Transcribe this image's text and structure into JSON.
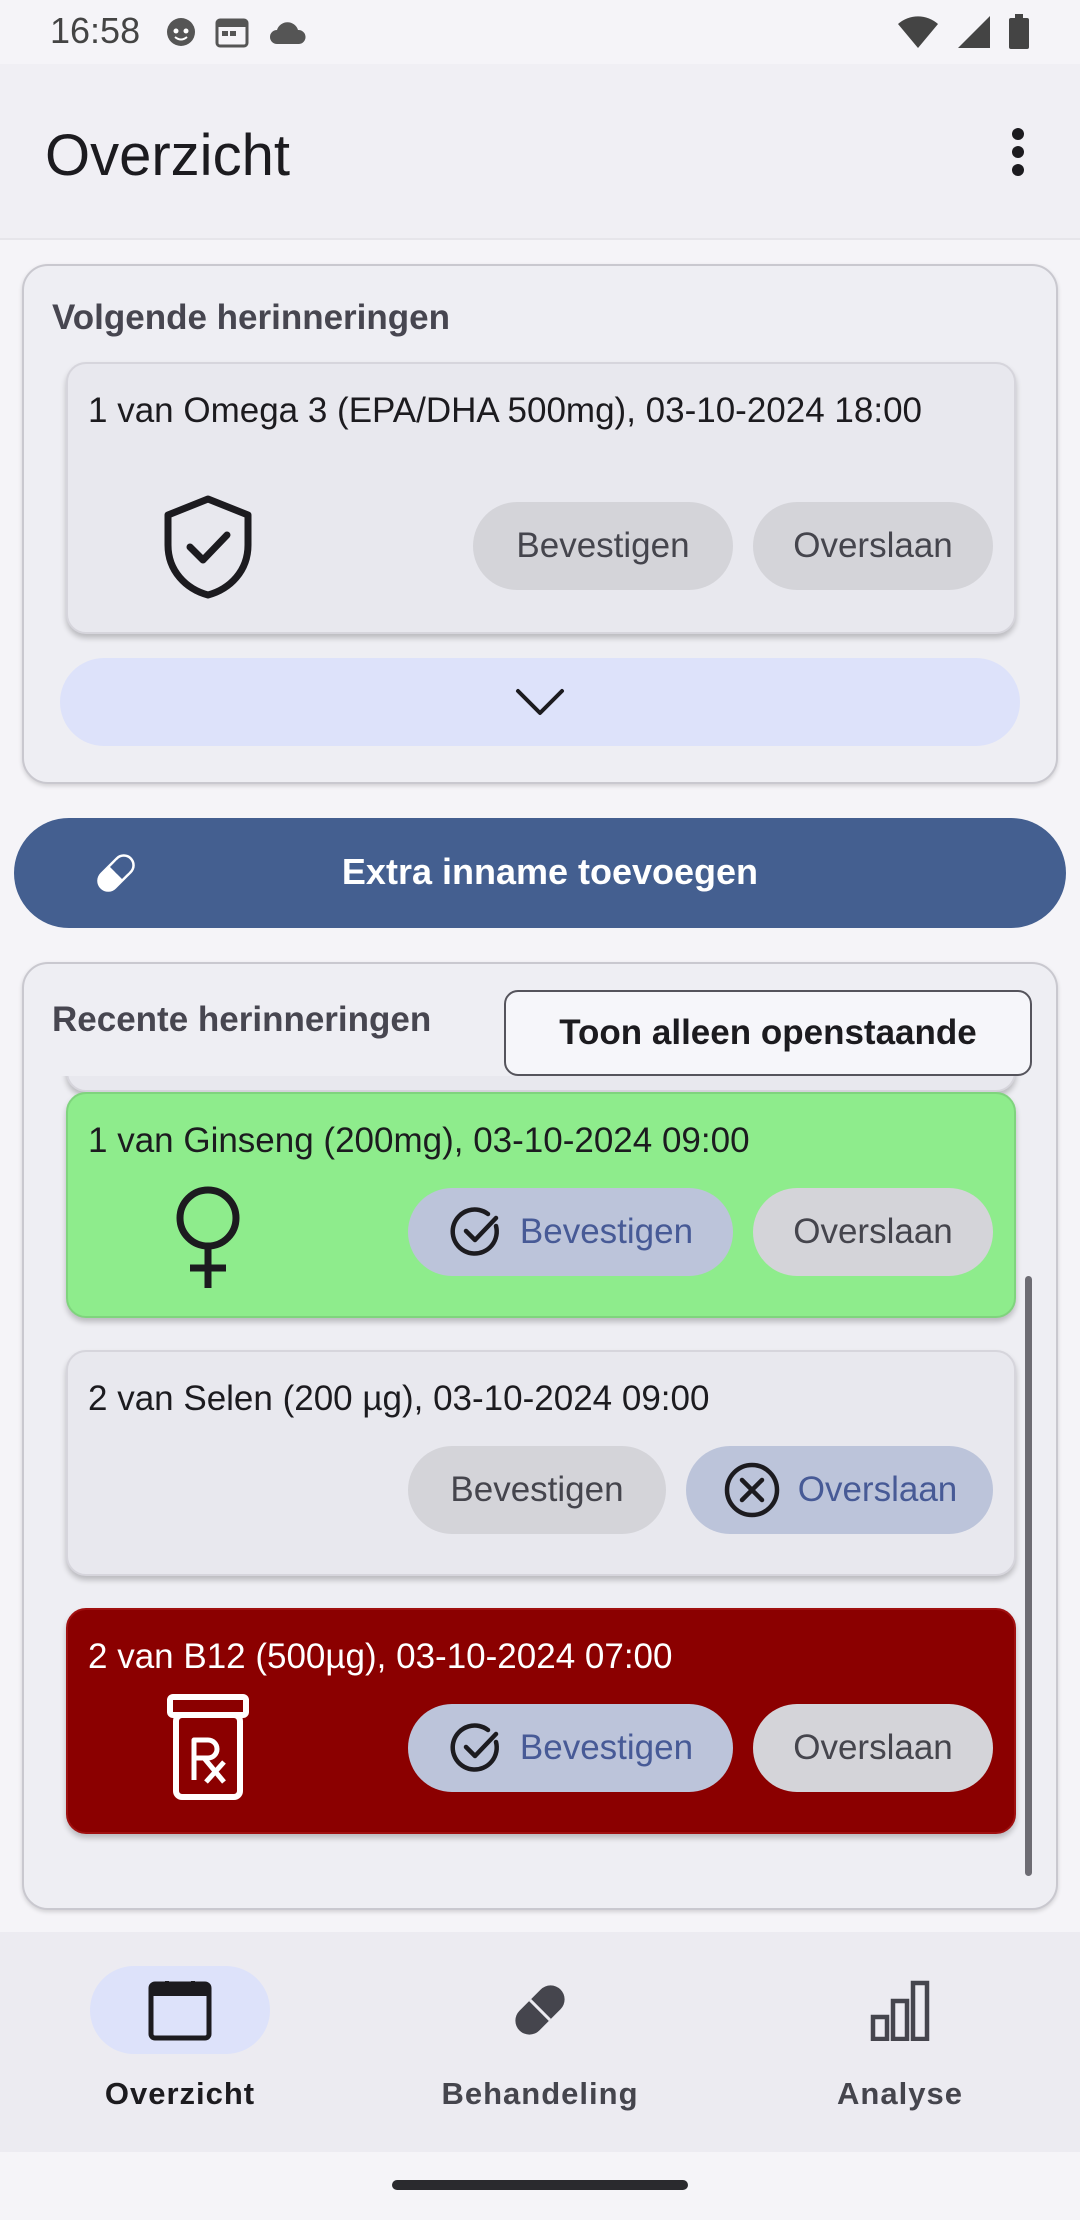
{
  "status_bar": {
    "time": "16:58"
  },
  "app_bar": {
    "title": "Overzicht",
    "overflow_icon": "more-vert-icon"
  },
  "upcoming": {
    "title": "Volgende herinneringen",
    "items": [
      {
        "text": "1 van Omega 3 (EPA/DHA 500mg), 03-10-2024 18:00",
        "icon": "shield-check-icon",
        "confirm_label": "Bevestigen",
        "skip_label": "Overslaan"
      }
    ],
    "expand_icon": "chevron-down-icon"
  },
  "fab": {
    "label": "Extra inname toevoegen",
    "icon": "pill-icon",
    "color": "#445f90"
  },
  "recent": {
    "title": "Recente herinneringen",
    "filter_label": "Toon alleen openstaande",
    "items": [
      {
        "text": "1 van Ginseng (200mg), 03-10-2024 09:00",
        "icon": "female-icon",
        "bg": "#8eec8c",
        "state": "confirmed",
        "confirm_label": "Bevestigen",
        "skip_label": "Overslaan"
      },
      {
        "text": "2 van Selen (200 µg), 03-10-2024 09:00",
        "icon": "",
        "bg": "#e8e8ee",
        "state": "skipped",
        "confirm_label": "Bevestigen",
        "skip_label": "Overslaan"
      },
      {
        "text": "2 van B12 (500µg), 03-10-2024 07:00",
        "icon": "prescription-bottle-icon",
        "bg": "#8b0000",
        "state": "confirmed",
        "confirm_label": "Bevestigen",
        "skip_label": "Overslaan"
      }
    ]
  },
  "bottom_nav": {
    "items": [
      {
        "label": "Overzicht",
        "icon": "calendar-icon",
        "active": true
      },
      {
        "label": "Behandeling",
        "icon": "pill-icon",
        "active": false
      },
      {
        "label": "Analyse",
        "icon": "bar-chart-icon",
        "active": false
      }
    ]
  }
}
